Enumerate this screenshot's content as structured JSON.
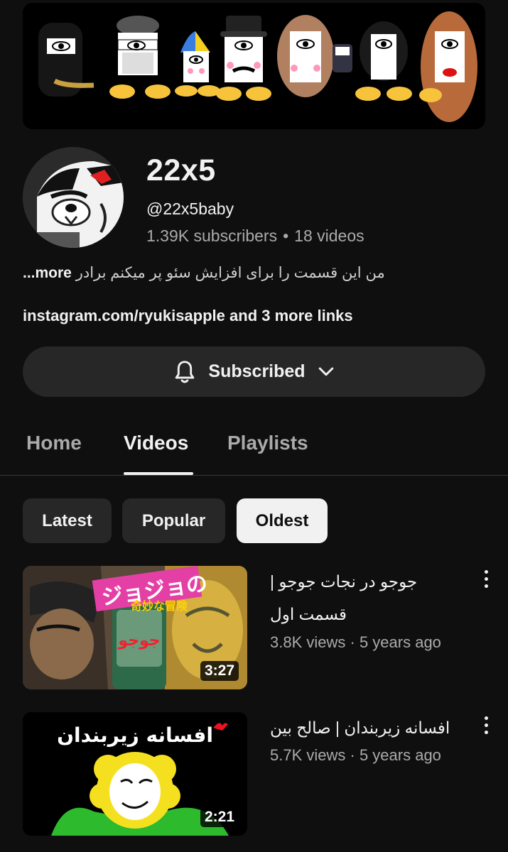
{
  "channel": {
    "name": "22x5",
    "handle": "@22x5baby",
    "subscribers": "1.39K subscribers",
    "separator": "•",
    "videos": "18 videos",
    "description": "من این قسمت را برای افزایش سئو پر میکنم برادر",
    "description_more": "...more",
    "links_primary": "instagram.com/ryukisapple",
    "links_and": "and",
    "links_more": "3 more links",
    "subscribe_label": "Subscribed"
  },
  "tabs": [
    {
      "label": "Home",
      "active": false
    },
    {
      "label": "Videos",
      "active": true
    },
    {
      "label": "Playlists",
      "active": false
    }
  ],
  "chips": [
    {
      "label": "Latest",
      "selected": false
    },
    {
      "label": "Popular",
      "selected": false
    },
    {
      "label": "Oldest",
      "selected": true
    }
  ],
  "videos": [
    {
      "title": "جوجو در نجات جوجو | قسمت اول",
      "views": "3.8K views",
      "age": "5 years ago",
      "duration": "3:27",
      "thumb_logo": "ジョジョの",
      "thumb_sub": "奇妙な冒険",
      "thumb_can": "جوجو"
    },
    {
      "title": "افسانه زیربندان | صالح بین",
      "views": "5.7K views",
      "age": "5 years ago",
      "duration": "2:21",
      "thumb_text": "افسانه زیربندان"
    }
  ],
  "icons": {
    "bell": "bell-icon",
    "chevron": "chevron-down-icon",
    "more": "more-vert-icon"
  },
  "colors": {
    "background": "#0f0f0f",
    "surface": "#272727",
    "text": "#f1f1f1",
    "muted": "#aaaaaa"
  }
}
